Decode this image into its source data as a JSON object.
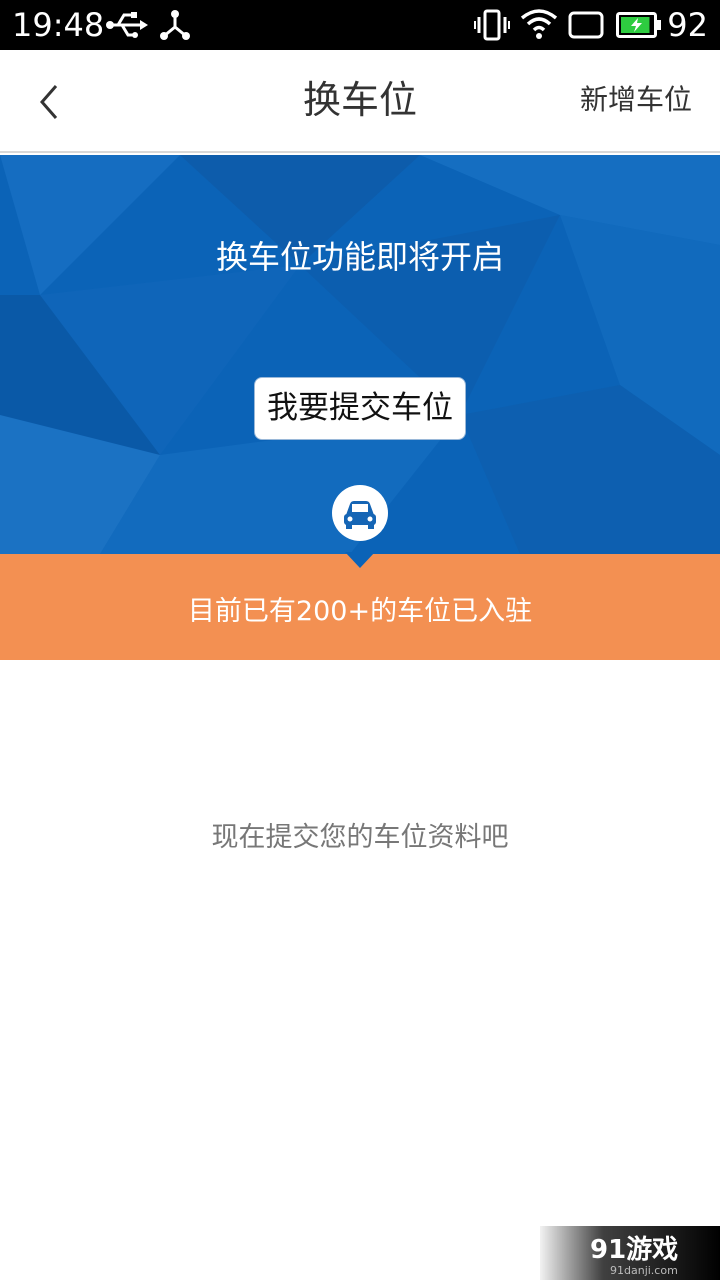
{
  "status_bar": {
    "time": "19:48",
    "battery_level": "92",
    "icons": [
      "usb-icon",
      "share-hub-icon",
      "vibrate-icon",
      "wifi-icon",
      "screen-rect-icon",
      "battery-charging-icon"
    ],
    "battery_color": "#2ecc40"
  },
  "header": {
    "back_icon": "chevron-left-icon",
    "title": "换车位",
    "action_label": "新增车位"
  },
  "hero": {
    "headline": "换车位功能即将开启",
    "button_label": "我要提交车位",
    "icon": "car-icon",
    "background_color": "#0b63b7"
  },
  "banner": {
    "text": "目前已有200+的车位已入驻",
    "color": "#f39052"
  },
  "content": {
    "empty_message": "现在提交您的车位资料吧"
  },
  "watermark": {
    "logo_text": "91游戏",
    "url_text": "91danji.com"
  }
}
